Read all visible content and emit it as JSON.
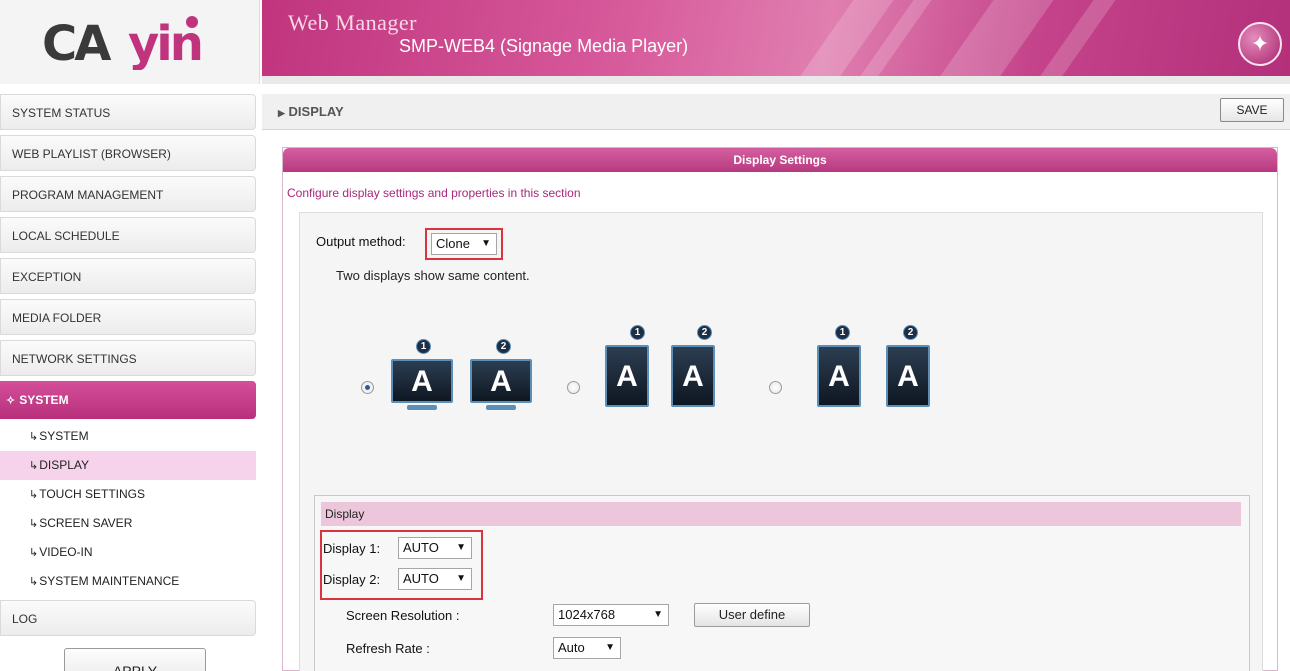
{
  "header": {
    "logo_text": "CAYIN",
    "title": "Web Manager",
    "subtitle": "SMP-WEB4 (Signage Media Player)"
  },
  "sidebar": {
    "items": [
      {
        "label": "SYSTEM STATUS"
      },
      {
        "label": "WEB PLAYLIST (BROWSER)"
      },
      {
        "label": "PROGRAM MANAGEMENT"
      },
      {
        "label": "LOCAL SCHEDULE"
      },
      {
        "label": "EXCEPTION"
      },
      {
        "label": "MEDIA FOLDER"
      },
      {
        "label": "NETWORK SETTINGS"
      }
    ],
    "active_section": "SYSTEM",
    "sub_items": [
      {
        "label": "SYSTEM"
      },
      {
        "label": "DISPLAY"
      },
      {
        "label": "TOUCH SETTINGS"
      },
      {
        "label": "SCREEN SAVER"
      },
      {
        "label": "VIDEO-IN"
      },
      {
        "label": "SYSTEM MAINTENANCE"
      }
    ],
    "selected_sub_item": "DISPLAY",
    "log_label": "LOG",
    "apply_label": "APPLY"
  },
  "breadcrumb": {
    "label": "DISPLAY",
    "save_label": "SAVE"
  },
  "panel": {
    "title": "Display Settings",
    "description": "Configure display settings and properties in this section",
    "output_method_label": "Output method:",
    "output_method_value": "Clone",
    "output_description": "Two displays show same content.",
    "layout_options": [
      {
        "orientation": "landscape",
        "selected": true
      },
      {
        "orientation": "portrait",
        "selected": false
      },
      {
        "orientation": "portrait",
        "selected": false
      }
    ],
    "monitor_letter": "A",
    "monitor_badges": [
      "1",
      "2"
    ],
    "display_section": {
      "title": "Display",
      "display1_label": "Display 1:",
      "display1_value": "AUTO",
      "display2_label": "Display 2:",
      "display2_value": "AUTO",
      "resolution_label": "Screen Resolution :",
      "resolution_value": "1024x768",
      "user_define_label": "User define",
      "refresh_label": "Refresh Rate :",
      "refresh_value": "Auto"
    }
  },
  "colors": {
    "brand": "#c0347e",
    "highlight": "#f6d3ea",
    "annotation_red": "#d9333f"
  }
}
